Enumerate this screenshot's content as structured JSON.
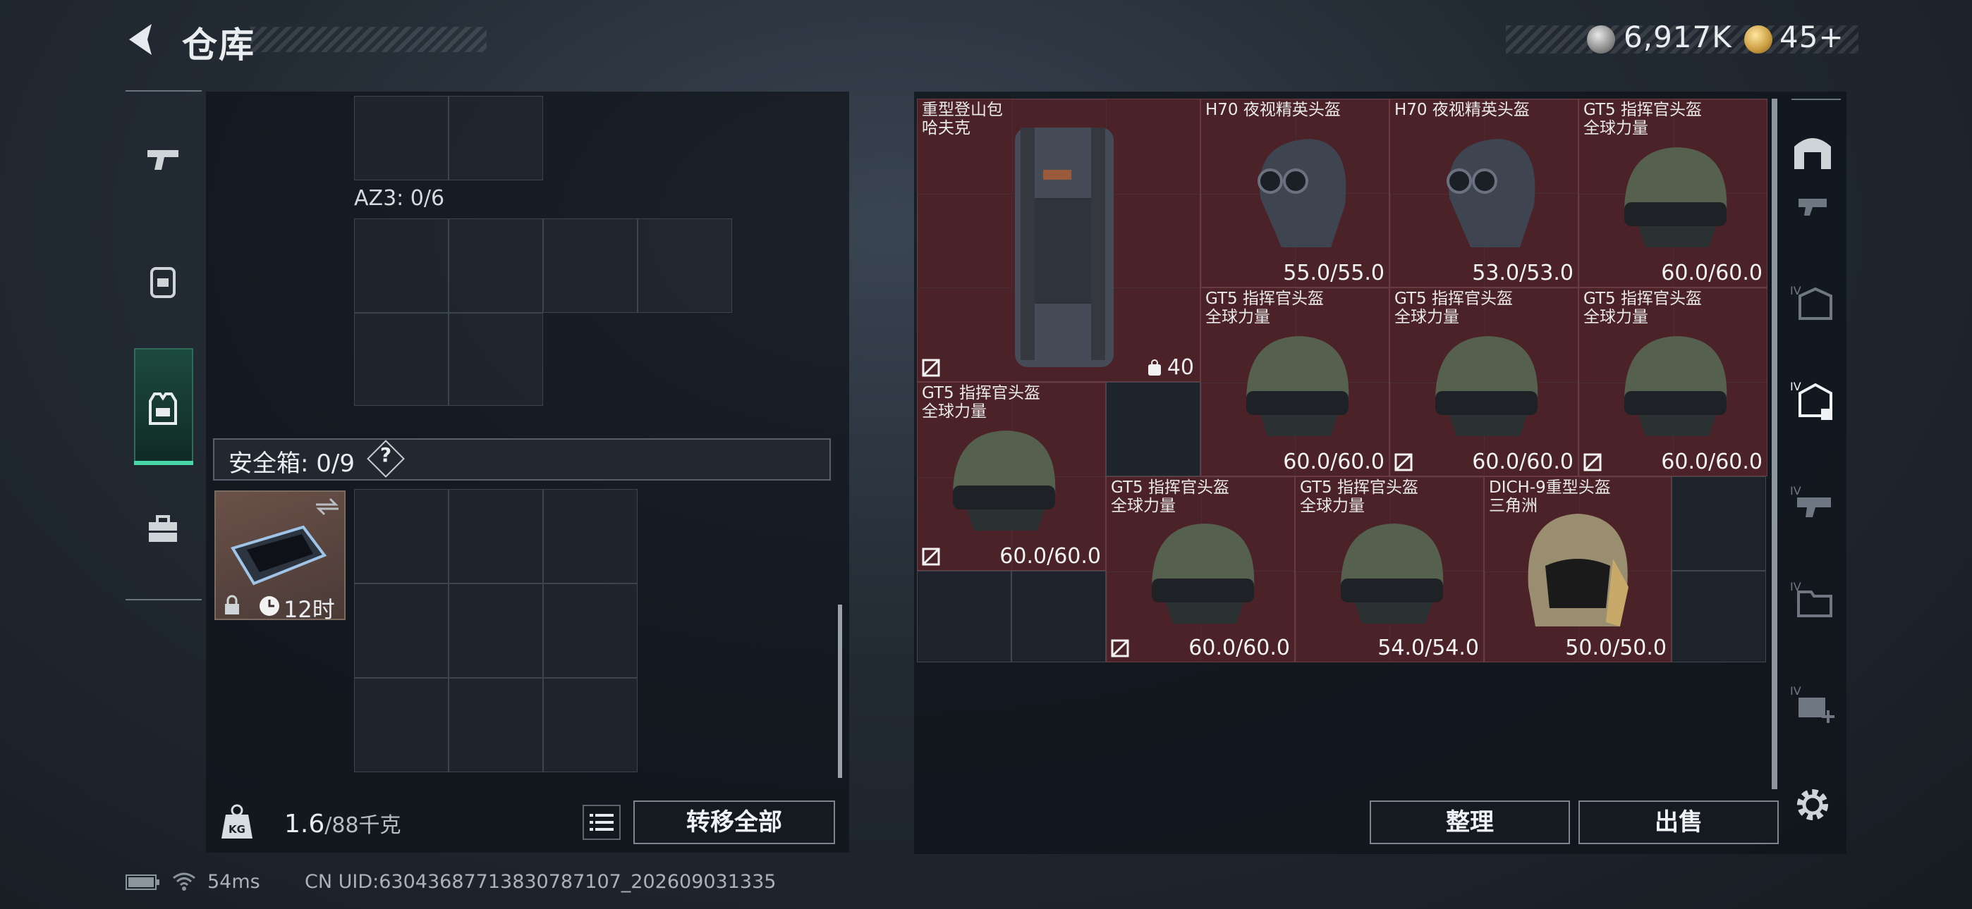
{
  "header": {
    "title": "仓库",
    "currency1": "6,917K",
    "currency2": "45+"
  },
  "left_nav": {
    "items": [
      "pistol-icon",
      "backpack-icon",
      "vest-icon",
      "case-icon"
    ],
    "active": "vest-icon"
  },
  "storage": {
    "az3_label": "AZ3: 0/6",
    "safe_box_label": "安全箱: 0/9",
    "safe_box_help": "?",
    "safe_item_time": "12时",
    "weight_value": "1.6",
    "weight_capacity": "/88千克",
    "transfer_all_label": "转移全部"
  },
  "items": [
    {
      "name_line1": "重型登山包",
      "name_line2": "哈夫克",
      "capacity": "40"
    },
    {
      "name_line1": "H70 夜视精英头盔",
      "name_line2": "",
      "durability": "55.0/55.0"
    },
    {
      "name_line1": "H70 夜视精英头盔",
      "name_line2": "",
      "durability": "53.0/53.0"
    },
    {
      "name_line1": "GT5 指挥官头盔",
      "name_line2": "全球力量",
      "durability": "60.0/60.0"
    },
    {
      "name_line1": "GT5 指挥官头盔",
      "name_line2": "全球力量",
      "durability": "60.0/60.0"
    },
    {
      "name_line1": "GT5 指挥官头盔",
      "name_line2": "全球力量",
      "durability": "60.0/60.0"
    },
    {
      "name_line1": "GT5 指挥官头盔",
      "name_line2": "全球力量",
      "durability": "60.0/60.0"
    },
    {
      "name_line1": "GT5 指挥官头盔",
      "name_line2": "全球力量",
      "durability": "60.0/60.0"
    },
    {
      "name_line1": "GT5 指挥官头盔",
      "name_line2": "全球力量",
      "durability": "60.0/60.0"
    },
    {
      "name_line1": "GT5 指挥官头盔",
      "name_line2": "全球力量",
      "durability": "54.0/54.0"
    },
    {
      "name_line1": "DICH-9重型头盔",
      "name_line2": "三角洲",
      "durability": "50.0/50.0"
    }
  ],
  "right_actions": {
    "sort_label": "整理",
    "sell_label": "出售"
  },
  "status_bar": {
    "ping": "54ms",
    "uid": "CN UID:6304368771383078​7107_202609031335"
  },
  "colors": {
    "accent_green": "#47d6a6",
    "item_bg": "#4a2228"
  }
}
